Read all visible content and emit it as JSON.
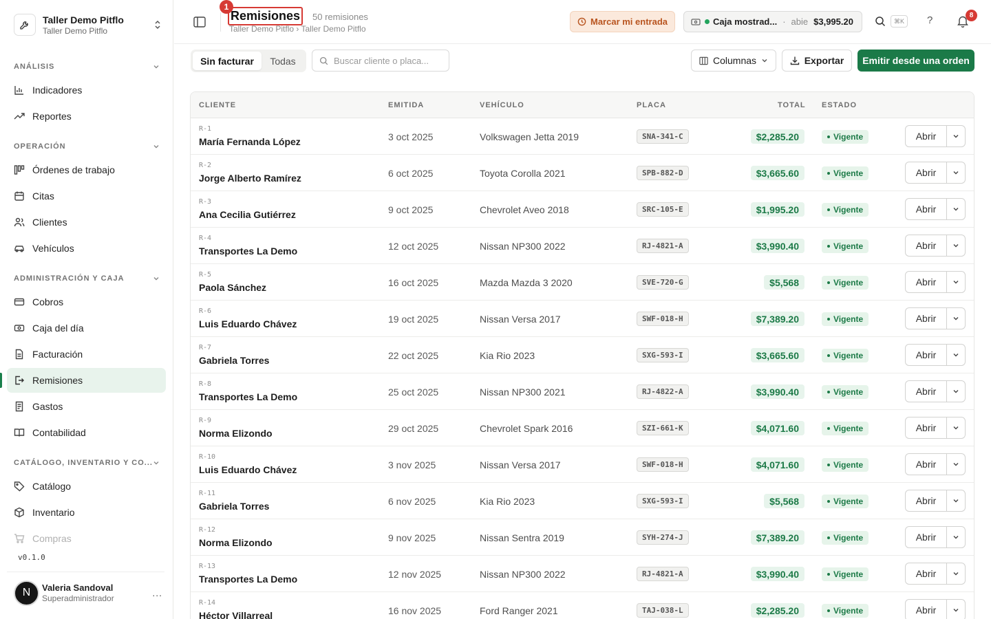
{
  "org": {
    "name": "Taller Demo Pitflo",
    "subtitle": "Taller Demo Pitflo"
  },
  "sidebar": {
    "sections": [
      {
        "label": "ANÁLISIS"
      },
      {
        "label": "OPERACIÓN"
      },
      {
        "label": "ADMINISTRACIÓN Y CAJA"
      },
      {
        "label": "CATÁLOGO, INVENTARIO Y CO..."
      }
    ],
    "items": [
      {
        "label": "Indicadores",
        "icon": "bar-chart-icon"
      },
      {
        "label": "Reportes",
        "icon": "trend-icon"
      },
      {
        "label": "Órdenes de trabajo",
        "icon": "kanban-icon"
      },
      {
        "label": "Citas",
        "icon": "calendar-icon"
      },
      {
        "label": "Clientes",
        "icon": "users-icon"
      },
      {
        "label": "Vehículos",
        "icon": "car-icon"
      },
      {
        "label": "Cobros",
        "icon": "card-icon"
      },
      {
        "label": "Caja del día",
        "icon": "cash-icon"
      },
      {
        "label": "Facturación",
        "icon": "invoice-icon"
      },
      {
        "label": "Remisiones",
        "icon": "export-icon"
      },
      {
        "label": "Gastos",
        "icon": "receipt-icon"
      },
      {
        "label": "Contabilidad",
        "icon": "book-icon"
      },
      {
        "label": "Catálogo",
        "icon": "tag-icon"
      },
      {
        "label": "Inventario",
        "icon": "box-icon"
      },
      {
        "label": "Compras",
        "icon": "cart-icon"
      }
    ],
    "active_item": "Remisiones",
    "version": "v0.1.0"
  },
  "user": {
    "initial": "N",
    "name": "Valeria Sandoval",
    "role": "Superadministrador",
    "more": "..."
  },
  "header": {
    "title": "Remisiones",
    "marker": "1",
    "count": "50 remisiones",
    "breadcrumb": "Taller Demo Pitflo › Taller Demo Pitflo",
    "entrada_label": "Marcar mi entrada",
    "caja_name": "Caja mostrad...",
    "caja_sep": "·",
    "caja_status": "abie",
    "caja_amount": "$3,995.20",
    "shortcut": "⌘K",
    "help": "?",
    "notifications": "8"
  },
  "toolbar": {
    "tab_sin_facturar": "Sin facturar",
    "tab_todas": "Todas",
    "search_placeholder": "Buscar cliente o placa...",
    "columns_label": "Columnas",
    "export_label": "Exportar",
    "primary_label": "Emitir desde una orden"
  },
  "table": {
    "headers": {
      "cliente": "CLIENTE",
      "emitida": "EMITIDA",
      "vehiculo": "VEHÍCULO",
      "placa": "PLACA",
      "total": "TOTAL",
      "estado": "ESTADO"
    },
    "open_label": "Abrir",
    "rows": [
      {
        "id": "R-1",
        "cliente": "María Fernanda López",
        "emitida": "3 oct 2025",
        "vehiculo": "Volkswagen Jetta 2019",
        "placa": "SNA-341-C",
        "total": "$2,285.20",
        "estado": "Vigente"
      },
      {
        "id": "R-2",
        "cliente": "Jorge Alberto Ramírez",
        "emitida": "6 oct 2025",
        "vehiculo": "Toyota Corolla 2021",
        "placa": "SPB-882-D",
        "total": "$3,665.60",
        "estado": "Vigente"
      },
      {
        "id": "R-3",
        "cliente": "Ana Cecilia Gutiérrez",
        "emitida": "9 oct 2025",
        "vehiculo": "Chevrolet Aveo 2018",
        "placa": "SRC-105-E",
        "total": "$1,995.20",
        "estado": "Vigente"
      },
      {
        "id": "R-4",
        "cliente": "Transportes La Demo",
        "emitida": "12 oct 2025",
        "vehiculo": "Nissan NP300 2022",
        "placa": "RJ-4821-A",
        "total": "$3,990.40",
        "estado": "Vigente"
      },
      {
        "id": "R-5",
        "cliente": "Paola Sánchez",
        "emitida": "16 oct 2025",
        "vehiculo": "Mazda Mazda 3 2020",
        "placa": "SVE-720-G",
        "total": "$5,568",
        "estado": "Vigente"
      },
      {
        "id": "R-6",
        "cliente": "Luis Eduardo Chávez",
        "emitida": "19 oct 2025",
        "vehiculo": "Nissan Versa 2017",
        "placa": "SWF-018-H",
        "total": "$7,389.20",
        "estado": "Vigente"
      },
      {
        "id": "R-7",
        "cliente": "Gabriela Torres",
        "emitida": "22 oct 2025",
        "vehiculo": "Kia Rio 2023",
        "placa": "SXG-593-I",
        "total": "$3,665.60",
        "estado": "Vigente"
      },
      {
        "id": "R-8",
        "cliente": "Transportes La Demo",
        "emitida": "25 oct 2025",
        "vehiculo": "Nissan NP300 2021",
        "placa": "RJ-4822-A",
        "total": "$3,990.40",
        "estado": "Vigente"
      },
      {
        "id": "R-9",
        "cliente": "Norma Elizondo",
        "emitida": "29 oct 2025",
        "vehiculo": "Chevrolet Spark 2016",
        "placa": "SZI-661-K",
        "total": "$4,071.60",
        "estado": "Vigente"
      },
      {
        "id": "R-10",
        "cliente": "Luis Eduardo Chávez",
        "emitida": "3 nov 2025",
        "vehiculo": "Nissan Versa 2017",
        "placa": "SWF-018-H",
        "total": "$4,071.60",
        "estado": "Vigente"
      },
      {
        "id": "R-11",
        "cliente": "Gabriela Torres",
        "emitida": "6 nov 2025",
        "vehiculo": "Kia Rio 2023",
        "placa": "SXG-593-I",
        "total": "$5,568",
        "estado": "Vigente"
      },
      {
        "id": "R-12",
        "cliente": "Norma Elizondo",
        "emitida": "9 nov 2025",
        "vehiculo": "Nissan Sentra 2019",
        "placa": "SYH-274-J",
        "total": "$7,389.20",
        "estado": "Vigente"
      },
      {
        "id": "R-13",
        "cliente": "Transportes La Demo",
        "emitida": "12 nov 2025",
        "vehiculo": "Nissan NP300 2022",
        "placa": "RJ-4821-A",
        "total": "$3,990.40",
        "estado": "Vigente"
      },
      {
        "id": "R-14",
        "cliente": "Héctor Villarreal",
        "emitida": "16 nov 2025",
        "vehiculo": "Ford Ranger 2021",
        "placa": "TAJ-038-L",
        "total": "$2,285.20",
        "estado": "Vigente"
      }
    ]
  },
  "colors": {
    "accent": "#1b7a48",
    "danger": "#d63a34",
    "warning_bg": "#fbe9dc"
  }
}
